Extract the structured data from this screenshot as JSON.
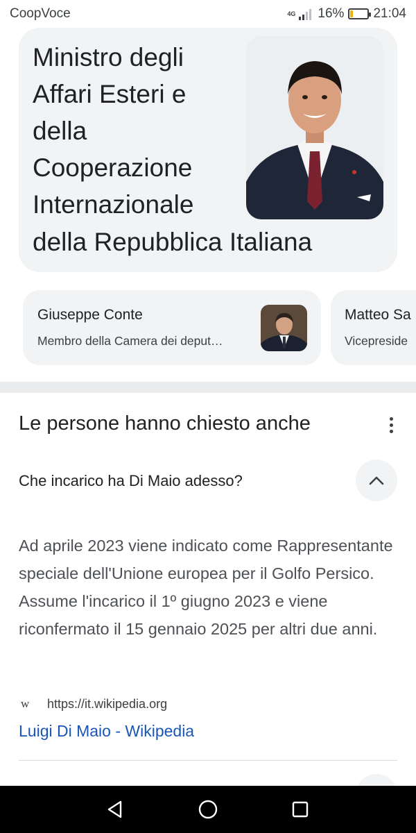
{
  "status_bar": {
    "carrier": "CoopVoce",
    "network": "4G",
    "battery_percent": "16%",
    "battery_level": 0.16,
    "time": "21:04",
    "icons": [
      "signal-icon",
      "battery-icon"
    ]
  },
  "knowledge_card": {
    "title_lines": [
      "Ministro degli",
      "Affari Esteri e",
      "della",
      "Cooperazione",
      "Internazionale"
    ],
    "title_last_line": "della Repubblica Italiana",
    "image": "portrait-photo"
  },
  "related_people": [
    {
      "name": "Giuseppe Conte",
      "role": "Membro della Camera dei deput…",
      "image": "person-thumbnail"
    },
    {
      "name": "Matteo Sa",
      "role": "Vicepreside"
    }
  ],
  "people_also_ask": {
    "title": "Le persone hanno chiesto anche",
    "question": "Che incarico ha Di Maio adesso?",
    "answer": "Ad aprile 2023 viene indicato come Rappresentante speciale dell'Unione europea per il Golfo Persico. Assume l'incarico il 1º giugno 2023 e viene riconfermato il 15 gennaio 2025 per altri due anni.",
    "source": {
      "icon_letter": "w",
      "url": "https://it.wikipedia.org",
      "link_text": "Luigi Di Maio - Wikipedia"
    }
  },
  "nav_bar": {
    "buttons": [
      "back-icon",
      "home-icon",
      "recents-icon"
    ]
  },
  "colors": {
    "card_bg": "#f1f3f4",
    "link": "#1a56b7",
    "battery": "#f2b400"
  }
}
